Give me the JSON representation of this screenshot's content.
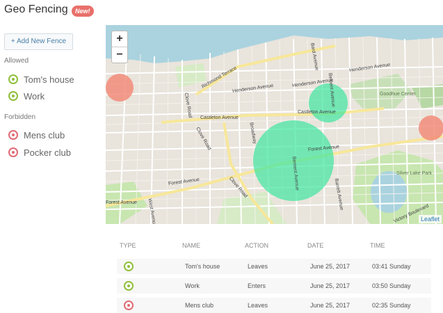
{
  "header": {
    "title": "Geo Fencing",
    "badge": "New!"
  },
  "sidebar": {
    "add_button": "+ Add New Fence",
    "allowed_label": "Allowed",
    "allowed": [
      {
        "label": "Tom's house"
      },
      {
        "label": "Work"
      }
    ],
    "forbidden_label": "Forbidden",
    "forbidden": [
      {
        "label": "Mens club"
      },
      {
        "label": "Pocker club"
      }
    ]
  },
  "map": {
    "zoom_in": "+",
    "zoom_out": "−",
    "attribution": "Leaflet",
    "streets": {
      "richmond": "Richmond Terrace",
      "henderson1": "Henderson Avenue",
      "henderson2": "Henderson Avenue",
      "henderson3": "Henderson Avenue",
      "castleton1": "Castleton Avenue",
      "castleton2": "Castleton Avenue",
      "forest1": "Forest Avenue",
      "forest2": "Forest Avenue",
      "forest3": "Forest Avenue",
      "clove1": "Clove Road",
      "clove2": "Clove Road",
      "clove3": "Clove Road",
      "broadway": "Broadway",
      "bard": "Bard Avenue",
      "barrett": "Barrett Avenue",
      "bement1": "Bement Avenue",
      "bement2": "Bement Avenue",
      "goodhue": "Goodhue Center",
      "silver": "Silver Lake Park",
      "victory": "Victory Boulevard",
      "west": "West Avenue"
    },
    "colors": {
      "allowed_fill": "#3ee6a0",
      "forbidden_fill": "#f28c7a"
    }
  },
  "log": {
    "headers": {
      "type": "TYPE",
      "name": "NAME",
      "action": "ACTION",
      "date": "DATE",
      "time": "TIME"
    },
    "rows": [
      {
        "type": "allowed",
        "name": "Tom's house",
        "action": "Leaves",
        "date": "June 25, 2017",
        "time": "03:41 Sunday"
      },
      {
        "type": "allowed",
        "name": "Work",
        "action": "Enters",
        "date": "June 25, 2017",
        "time": "03:50 Sunday"
      },
      {
        "type": "forbidden",
        "name": "Mens club",
        "action": "Leaves",
        "date": "June 25, 2017",
        "time": "02:35 Sunday"
      }
    ]
  }
}
